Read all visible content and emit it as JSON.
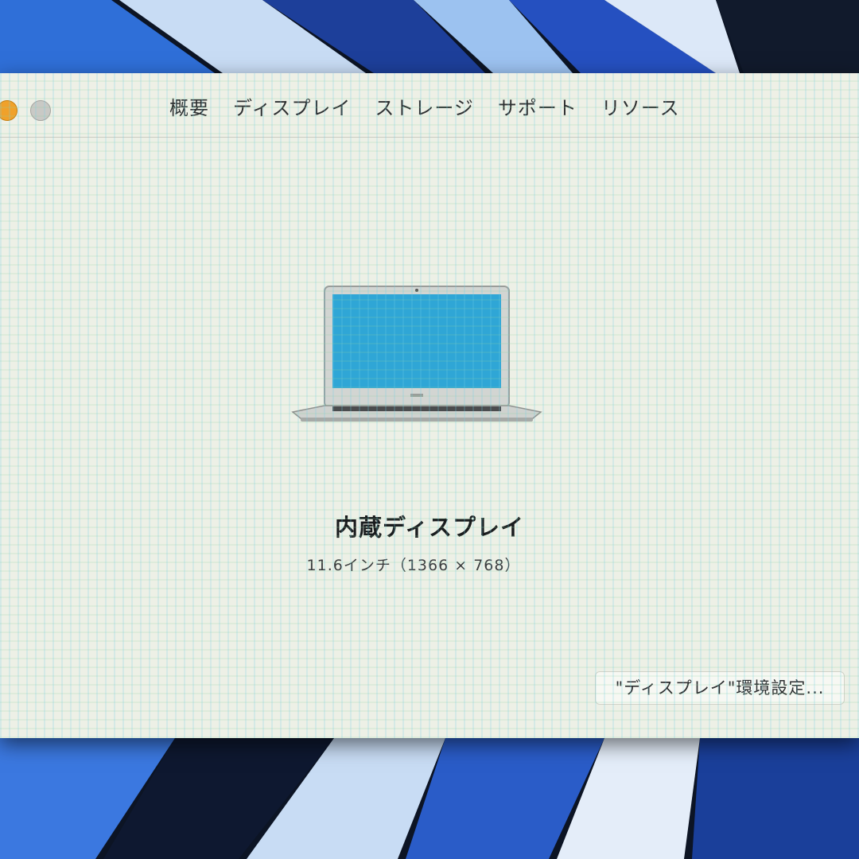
{
  "window": {
    "tabs": [
      "概要",
      "ディスプレイ",
      "ストレージ",
      "サポート",
      "リソース"
    ],
    "selected_tab": "ディスプレイ"
  },
  "display": {
    "name": "内蔵ディスプレイ",
    "spec": "11.6インチ（1366 × 768）",
    "preferences_button": "\"ディスプレイ\"環境設定..."
  },
  "icons": {
    "minimize": "minimize-button-icon",
    "zoom": "zoom-button-icon",
    "display": "macbook-air-laptop-icon"
  },
  "colors": {
    "window_bg": "#edf0e6",
    "minimize": "#f0a12a",
    "zoom": "#c9c9c5",
    "laptop_screen": "#2fa6d6",
    "wallpaper": "#0c1424"
  }
}
